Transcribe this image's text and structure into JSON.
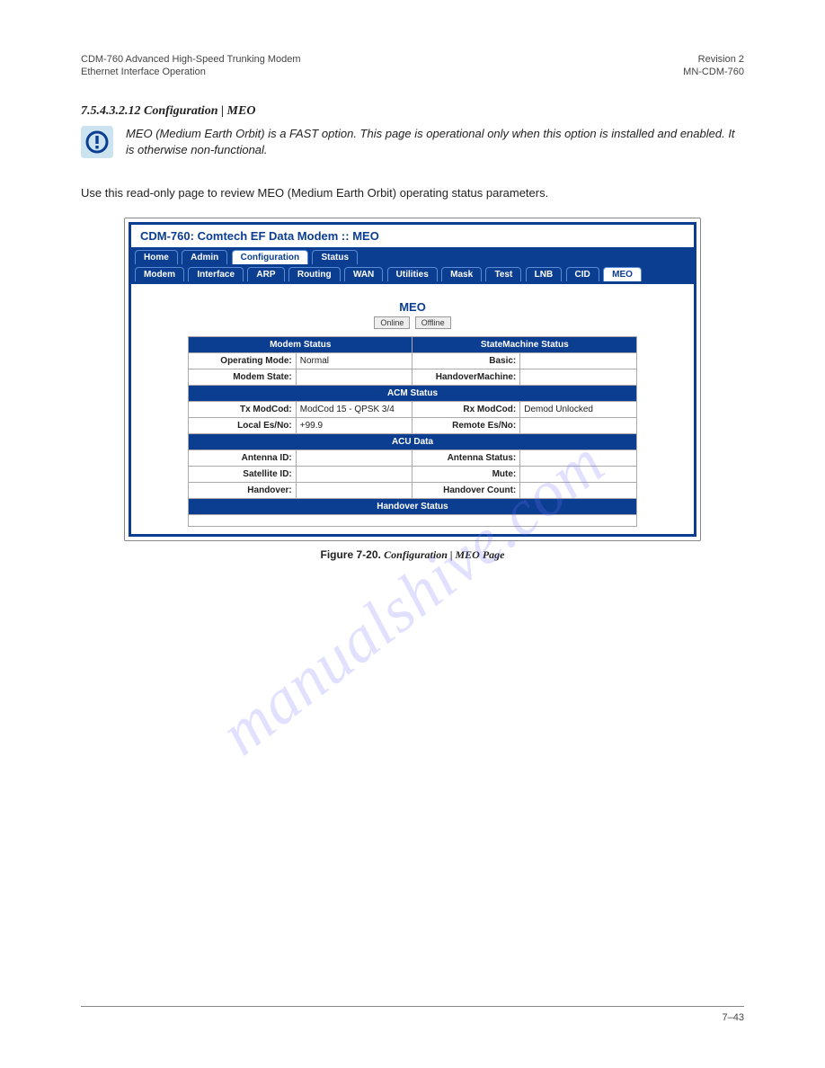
{
  "header": {
    "left": "CDM-760 Advanced High-Speed Trunking Modem",
    "right": "Revision 2"
  },
  "subheader": {
    "left": "Ethernet Interface Operation",
    "right": "MN-CDM-760"
  },
  "section_heading": "7.5.4.3.2.12   Configuration | MEO",
  "note": "MEO (Medium Earth Orbit) is a FAST option. This page is operational only when this option is installed and enabled. It is otherwise non-functional.",
  "body_para": "Use this read-only page to review MEO (Medium Earth Orbit) operating status parameters.",
  "screenshot": {
    "title": "CDM-760: Comtech EF Data Modem :: MEO",
    "tabs1": [
      {
        "label": "Home",
        "active": false
      },
      {
        "label": "Admin",
        "active": false
      },
      {
        "label": "Configuration",
        "active": true
      },
      {
        "label": "Status",
        "active": false
      }
    ],
    "tabs2": [
      {
        "label": "Modem",
        "active": false
      },
      {
        "label": "Interface",
        "active": false
      },
      {
        "label": "ARP",
        "active": false
      },
      {
        "label": "Routing",
        "active": false
      },
      {
        "label": "WAN",
        "active": false
      },
      {
        "label": "Utilities",
        "active": false
      },
      {
        "label": "Mask",
        "active": false
      },
      {
        "label": "Test",
        "active": false
      },
      {
        "label": "LNB",
        "active": false
      },
      {
        "label": "CID",
        "active": false
      },
      {
        "label": "MEO",
        "active": true
      }
    ],
    "page_title": "MEO",
    "btn_online": "Online",
    "btn_offline": "Offline",
    "hdr_modem_status": "Modem Status",
    "hdr_smc_status": "StateMachine Status",
    "row_mode": {
      "l": "Operating Mode:",
      "v": "Normal",
      "r": "Basic:",
      "rv": ""
    },
    "row_state": {
      "l": "Modem State:",
      "v": "",
      "r": "HandoverMachine:",
      "rv": ""
    },
    "hdr_acm": "ACM Status",
    "row_txmc": {
      "l": "Tx ModCod:",
      "v": "ModCod 15 - QPSK 3/4",
      "r": "Rx ModCod:",
      "rv": "Demod Unlocked"
    },
    "row_esno": {
      "l": "Local Es/No:",
      "v": "+99.9",
      "r": "Remote Es/No:",
      "rv": ""
    },
    "hdr_acu": "ACU Data",
    "row_ant": {
      "l": "Antenna ID:",
      "v": "",
      "r": "Antenna Status:",
      "rv": ""
    },
    "row_sat": {
      "l": "Satellite ID:",
      "v": "",
      "r": "Mute:",
      "rv": ""
    },
    "row_ho": {
      "l": "Handover:",
      "v": "",
      "r": "Handover Count:",
      "rv": ""
    },
    "hdr_ho_status": "Handover Status"
  },
  "caption_prefix": "Figure 7-20. ",
  "caption_body": "Configuration | MEO Page",
  "watermark": "manualshive.com",
  "footer": {
    "left": "",
    "right": "7–43"
  }
}
